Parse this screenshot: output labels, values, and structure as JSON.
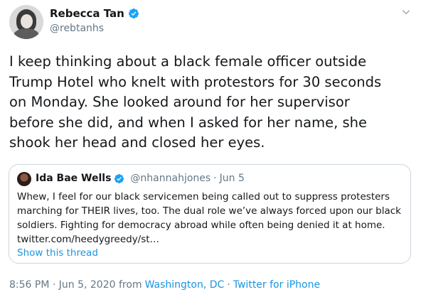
{
  "author": {
    "name": "Rebecca Tan",
    "handle": "@rebtanhs",
    "verified": true,
    "avatar_icon": "profile-photo"
  },
  "tweet": {
    "text": "I keep thinking about a black female officer outside\nTrump Hotel who knelt with protestors for 30 seconds\non Monday. She looked around for her supervisor\nbefore she did, and when I asked for her name, she\nshook her head and closed her eyes."
  },
  "quoted": {
    "name": "Ida Bae Wells",
    "handle": "@nhannahjones",
    "separator": "·",
    "date": "Jun 5",
    "verified": true,
    "text": "Whew, I feel for our black servicemen being called out to suppress protesters\nmarching for THEIR lives, too. The dual role we’ve always forced upon our black\nsoldiers. Fighting for democracy abroad while often being denied it at home.\ntwitter.com/heedygreedy/st…",
    "show_thread": "Show this thread"
  },
  "meta": {
    "timestamp": "8:56 PM · Jun 5, 2020 from",
    "location": "Washington, DC",
    "separator": "·",
    "source": "Twitter for iPhone"
  },
  "colors": {
    "verified": "#1da1f2",
    "link": "#1b95e0",
    "secondary_text": "#657786",
    "border": "#ccd6dd"
  }
}
